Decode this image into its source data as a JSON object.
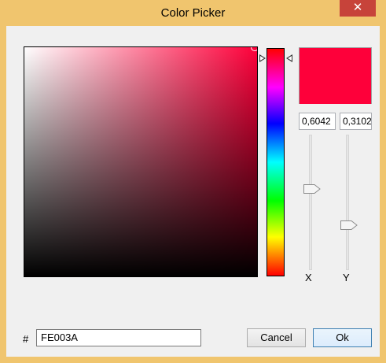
{
  "window": {
    "title": "Color Picker",
    "close_glyph": "✕"
  },
  "colors": {
    "current": "#FE003A",
    "hue": "#FF0000",
    "titlebar": "#F0C56E",
    "close": "#C7433A"
  },
  "picker": {
    "x_value": "0,6042",
    "y_value": "0,3102",
    "x_label": "X",
    "y_label": "Y",
    "x_slider_fraction": 0.6042,
    "y_slider_fraction": 0.3102
  },
  "hex": {
    "prefix": "#",
    "value": "FE003A"
  },
  "buttons": {
    "cancel": "Cancel",
    "ok": "Ok"
  },
  "icons": {
    "close": "close-icon"
  }
}
